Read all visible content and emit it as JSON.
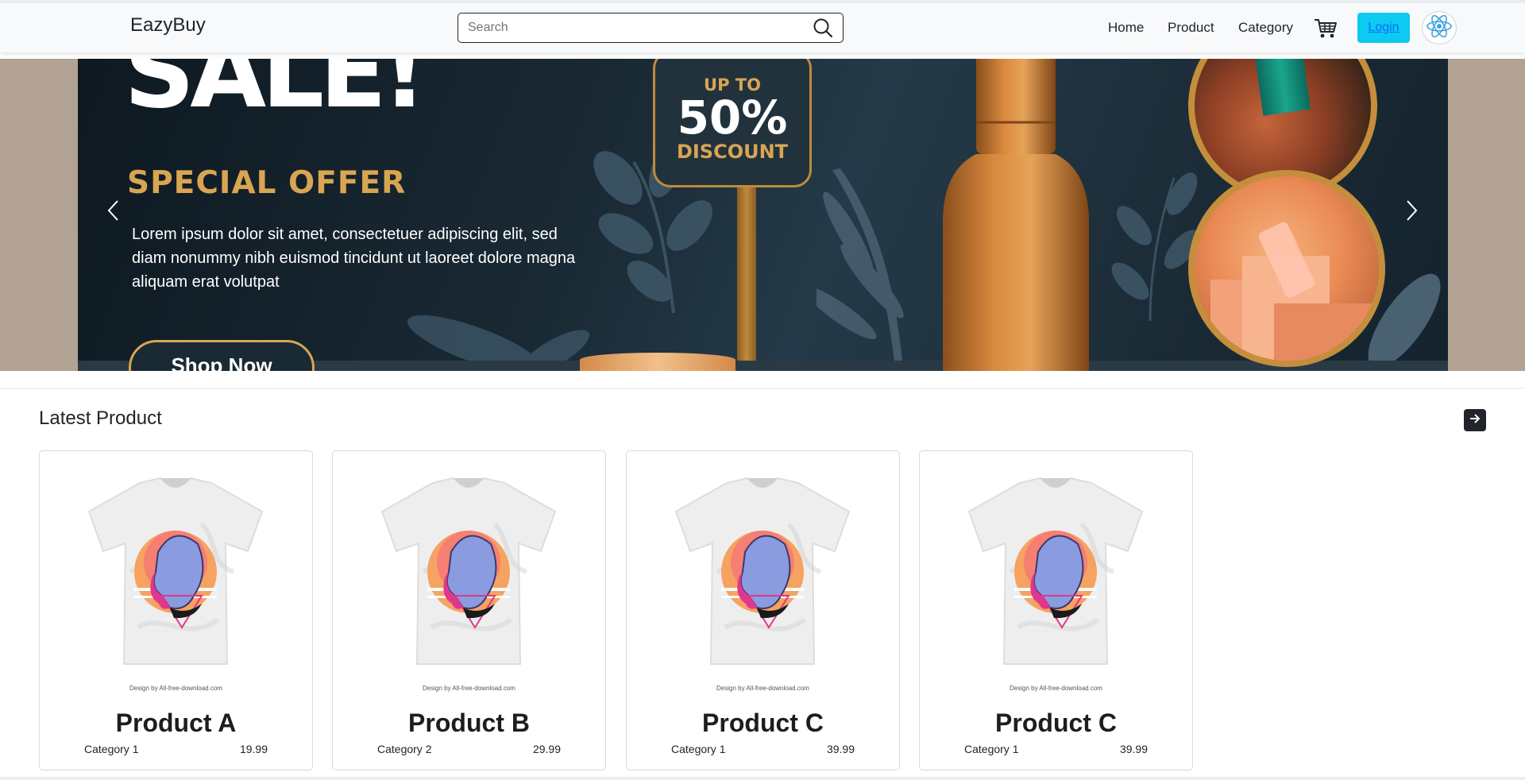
{
  "navbar": {
    "brand": "EazyBuy",
    "search_placeholder": "Search",
    "links": [
      "Home",
      "Product",
      "Category"
    ],
    "login_label": "Login",
    "icons": {
      "search": "search-icon",
      "cart": "cart-icon",
      "avatar": "react-atom-icon"
    },
    "login_bg_color": "#0dcaf0"
  },
  "hero": {
    "headline": "SALE!",
    "offer": "SPECIAL OFFER",
    "description": "Lorem ipsum dolor sit amet, consectetuer adipiscing elit, sed diam nonummy nibh euismod tincidunt ut laoreet dolore magna aliquam erat volutpat",
    "button_label": "Shop Now",
    "sign": {
      "up_to": "UP TO",
      "percent": "50%",
      "discount": "DISCOUNT"
    },
    "accent_color": "#d9a552",
    "icons": {
      "prev": "chevron-left-icon",
      "next": "chevron-right-icon"
    }
  },
  "latest": {
    "title": "Latest Product",
    "next_icon": "arrow-right-icon",
    "products": [
      {
        "name": "Product A",
        "category": "Category 1",
        "price": "19.99",
        "credit": "Design by All-free-download.com"
      },
      {
        "name": "Product B",
        "category": "Category 2",
        "price": "29.99",
        "credit": "Design by All-free-download.com"
      },
      {
        "name": "Product C",
        "category": "Category 1",
        "price": "39.99",
        "credit": "Design by All-free-download.com"
      },
      {
        "name": "Product C",
        "category": "Category 1",
        "price": "39.99",
        "credit": "Design by All-free-download.com"
      }
    ]
  }
}
